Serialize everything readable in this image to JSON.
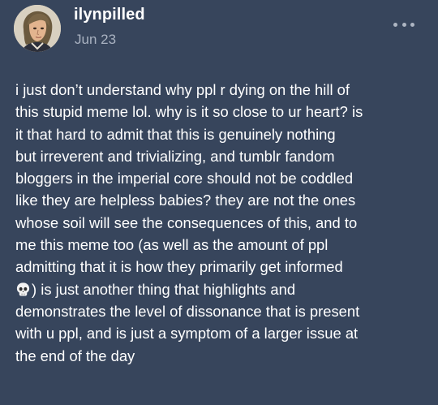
{
  "post": {
    "username": "ilynpilled",
    "date": "Jun 23",
    "more_menu_icon": "ellipsis-icon",
    "avatar_icon": "avatar",
    "emoji": "skull",
    "lines": [
      "i just don’t understand why ppl r dying on the hill of",
      "this stupid meme lol. why is it so close to ur heart? is",
      "it that hard to admit that this is genuinely nothing",
      "but irreverent and trivializing, and tumblr fandom",
      "bloggers in the imperial core should not be coddled",
      "like they are helpless babies? they are not the ones",
      "whose soil will see the consequences of this, and to",
      "me this meme too (as well as the amount of ppl",
      "admitting that it is how they primarily get informed",
      ") is just another thing that highlights and",
      "demonstrates the level of dissonance that is present",
      "with u ppl, and is just a symptom of a larger issue at",
      "the end of the day"
    ]
  },
  "colors": {
    "background": "#37455c",
    "text": "#ffffff",
    "muted": "#a9b2c1"
  }
}
